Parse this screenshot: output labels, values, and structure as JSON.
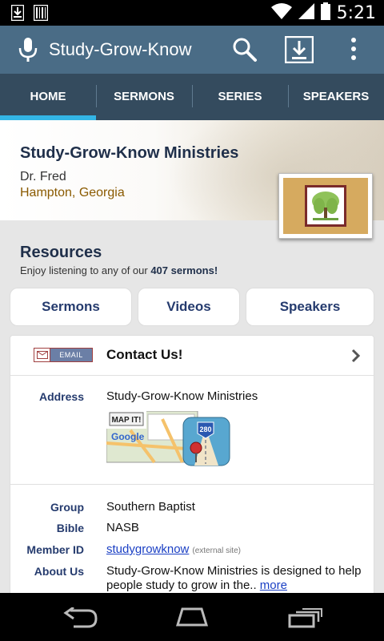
{
  "status_bar": {
    "time": "5:21"
  },
  "action_bar": {
    "title": "Study-Grow-Know"
  },
  "tabs": [
    {
      "label": "HOME",
      "active": true
    },
    {
      "label": "SERMONS",
      "active": false
    },
    {
      "label": "SERIES",
      "active": false
    },
    {
      "label": "SPEAKERS",
      "active": false
    }
  ],
  "header": {
    "title": "Study-Grow-Know Ministries",
    "speaker": "Dr. Fred",
    "location": "Hampton, Georgia"
  },
  "resources": {
    "title": "Resources",
    "subtitle_pre": "Enjoy listening to any of our ",
    "subtitle_bold": "407 sermons!",
    "buttons": {
      "sermons": "Sermons",
      "videos": "Videos",
      "speakers": "Speakers"
    }
  },
  "contact": {
    "email_badge": "EMAIL",
    "label": "Contact Us!"
  },
  "details": {
    "address_label": "Address",
    "address_value": "Study-Grow-Know Ministries",
    "map_badge": "MAP IT!",
    "map_brand": "Google",
    "map_route": "280",
    "group_label": "Group",
    "group_value": "Southern Baptist",
    "bible_label": "Bible",
    "bible_value": "NASB",
    "member_label": "Member ID",
    "member_value": "studygrowknow",
    "external_note": "(external site)",
    "about_label": "About Us",
    "about_value": "Study-Grow-Know Ministries is designed to help people study to grow in the..",
    "more_link": "more"
  },
  "colors": {
    "action_bar": "#4a6c86",
    "tab_bar": "#344b5e",
    "tab_indicator": "#33b5e5",
    "accent_text": "#253b6e"
  }
}
